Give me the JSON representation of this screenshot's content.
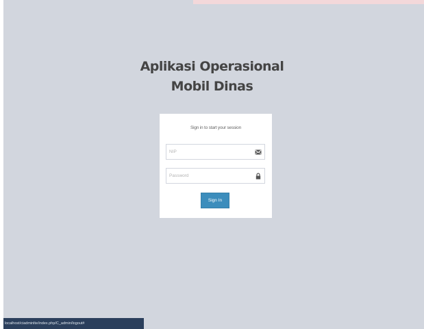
{
  "app": {
    "title_line1": "Aplikasi Operasional",
    "title_line2": "Mobil Dinas"
  },
  "login": {
    "message": "Sign in to start your session",
    "nip_placeholder": "NIP",
    "nip_value": "",
    "nip_icon": "envelope-icon",
    "password_placeholder": "Password",
    "password_value": "",
    "password_icon": "lock-icon",
    "signin_label": "Sign In"
  },
  "statusbar": {
    "url": "localhost/ciadminlte/index.php/C_admin/logout#"
  },
  "colors": {
    "background": "#d2d6de",
    "button": "#3c8dbc",
    "statusbar": "#2b3f5c",
    "top_strip": "#f3d8da"
  }
}
